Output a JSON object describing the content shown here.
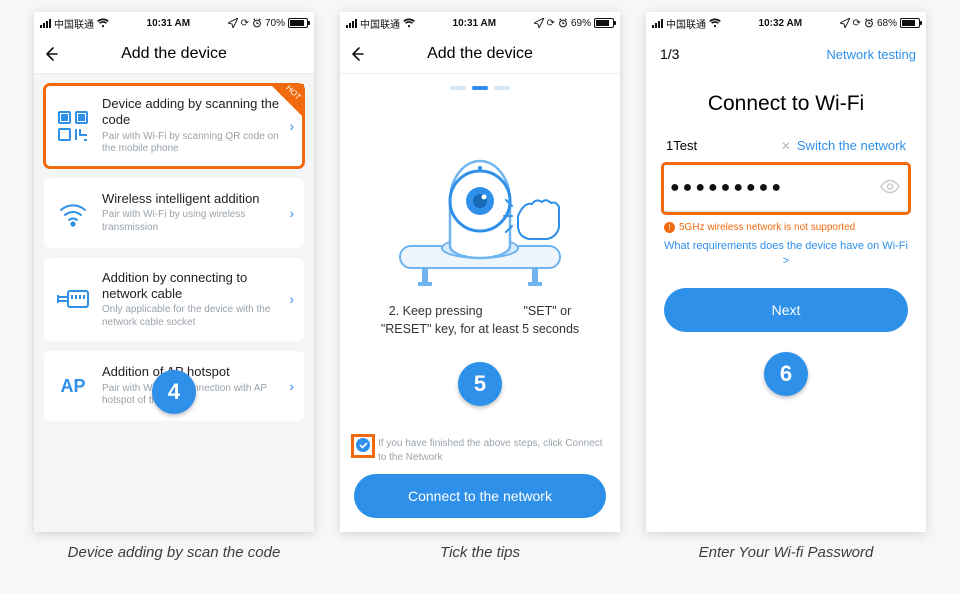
{
  "statusbar": {
    "carrier": "中国联通",
    "time_a": "10:31 AM",
    "time_b": "10:31 AM",
    "time_c": "10:32 AM",
    "batt_a": "70%",
    "batt_b": "69%",
    "batt_c": "68%",
    "batt_fill_a": 14,
    "batt_fill_b": 13,
    "batt_fill_c": 13
  },
  "phone1": {
    "header": "Add the device",
    "hot_label": "HOT",
    "cards": [
      {
        "title": "Device adding by scanning the code",
        "sub": "Pair with Wi-Fi by scanning QR code on the mobile phone"
      },
      {
        "title": "Wireless intelligent addition",
        "sub": "Pair with Wi-Fi by using wireless transmission"
      },
      {
        "title": "Addition by connecting to network cable",
        "sub": "Only applicable for the device with the network cable socket"
      },
      {
        "title": "Addition of AP hotspot",
        "sub": "Pair with Wi-Fi by connection with AP hotspot of the device"
      }
    ],
    "ap_label": "AP"
  },
  "phone2": {
    "header": "Add the device",
    "instruction_prefix": "2. Keep pressing",
    "instruction_mid": "\"SET\" or \"RESET\" key, for at least 5 seconds",
    "tick_text": "If you have finished the above steps, click Connect to the Network",
    "button": "Connect to the network"
  },
  "phone3": {
    "step_indicator": "1/3",
    "right_link": "Network testing",
    "title": "Connect to Wi-Fi",
    "ssid": "1Test",
    "switch_label": "Switch the network",
    "password_mask": "●●●●●●●●●",
    "warn": "5GHz wireless network is not supported",
    "req_link": "What requirements does the device have on Wi-Fi >",
    "button": "Next"
  },
  "badges": {
    "b4": "4",
    "b5": "5",
    "b6": "6"
  },
  "captions": {
    "c1": "Device adding by scan the code",
    "c2": "Tick the tips",
    "c3": "Enter Your Wi-fi Password"
  }
}
